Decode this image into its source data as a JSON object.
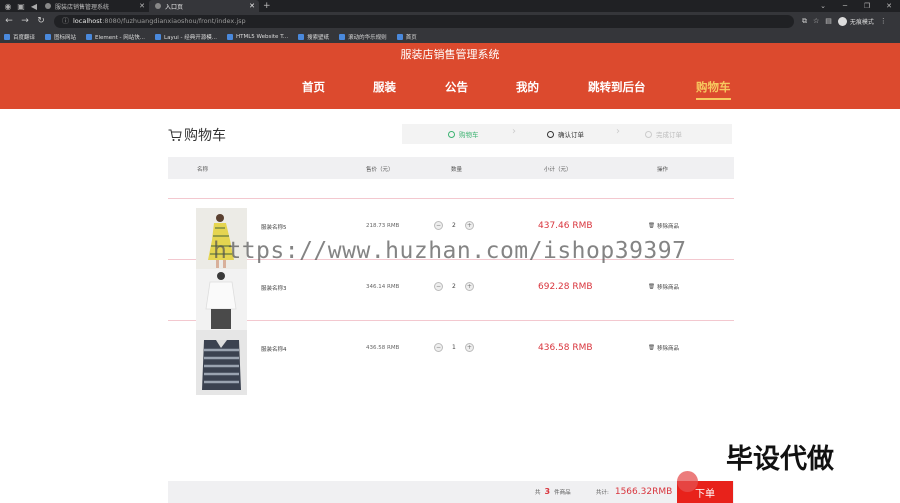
{
  "browser": {
    "tabs": [
      {
        "title": "服装店销售管理系统",
        "active": false
      },
      {
        "title": "入口页",
        "active": true
      }
    ],
    "url_host": "localhost",
    "url_rest": ":8080/fuzhuangdianxiaoshou/front/index.jsp",
    "profile_label": "无痕模式",
    "bookmarks": [
      "百度翻译",
      "图标网站",
      "Element - 网站快...",
      "Layui - 经典开源模...",
      "HTML5 Website T...",
      "搜索壁纸",
      "滚动的华乐规则",
      "首页"
    ]
  },
  "site": {
    "title": "服装店销售管理系统",
    "nav": [
      "首页",
      "服装",
      "公告",
      "我的",
      "跳转到后台",
      "购物车"
    ]
  },
  "cart": {
    "title": "购物车",
    "steps": [
      "购物车",
      "确认订单",
      "完成订单"
    ],
    "columns": {
      "name": "名称",
      "price": "售价（元）",
      "qty": "数量",
      "subtotal": "小计（元）",
      "action": "操作"
    },
    "items": [
      {
        "name": "服装名称5",
        "price": "218.73 RMB",
        "qty": "2",
        "subtotal": "437.46 RMB",
        "remove": "移除商品"
      },
      {
        "name": "服装名称3",
        "price": "346.14 RMB",
        "qty": "2",
        "subtotal": "692.28 RMB",
        "remove": "移除商品"
      },
      {
        "name": "服装名称4",
        "price": "436.58 RMB",
        "qty": "1",
        "subtotal": "436.58 RMB",
        "remove": "移除商品"
      }
    ],
    "footer": {
      "count_prefix": "共",
      "count": "3",
      "count_suffix": "件商品",
      "total_label": "共计:",
      "total": "1566.32RMB",
      "order_button": "下单"
    }
  },
  "watermarks": {
    "url": "https://www.huzhan.com/ishop39397",
    "cn": "毕设代做"
  },
  "colors": {
    "brand": "#dc4a2e",
    "nav_active": "#f7c85f",
    "price_red": "#d9363e",
    "step_done": "#3cb371",
    "order_button": "#e8221b"
  }
}
